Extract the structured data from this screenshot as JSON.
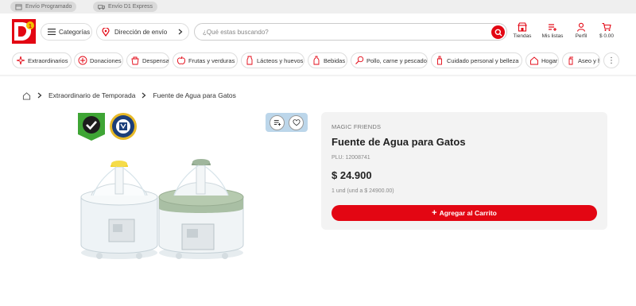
{
  "top_strip": {
    "scheduled": "Envío Programado",
    "express": "Envío D1 Express"
  },
  "header": {
    "logo_text": "D1",
    "categories_label": "Categorías",
    "address_label": "Dirección de envío",
    "search_placeholder": "¿Qué estas buscando?",
    "stores_label": "Tiendas",
    "lists_label": "Mis listas",
    "profile_label": "Perfil",
    "cart_label": "$ 0.00"
  },
  "categories": [
    {
      "label": "Extraordinarios",
      "icon": "sparkle-icon"
    },
    {
      "label": "Donaciones",
      "icon": "donation-icon"
    },
    {
      "label": "Despensa",
      "icon": "pantry-icon"
    },
    {
      "label": "Frutas y verduras",
      "icon": "apple-icon"
    },
    {
      "label": "Lácteos y huevos",
      "icon": "milk-icon"
    },
    {
      "label": "Bebidas",
      "icon": "bottle-icon"
    },
    {
      "label": "Pollo, carne y pescado",
      "icon": "drumstick-icon"
    },
    {
      "label": "Cuidado personal y belleza",
      "icon": "lotion-icon"
    },
    {
      "label": "Hogar",
      "icon": "home-icon"
    },
    {
      "label": "Aseo y h",
      "icon": "cleaning-icon"
    }
  ],
  "more_label": "⋮",
  "breadcrumb": {
    "level1": "Extraordinario de Temporada",
    "level2": "Fuente de Agua para Gatos"
  },
  "product": {
    "brand": "MAGIC FRIENDS",
    "name": "Fuente de Agua para Gatos",
    "plu": "PLU: 12008741",
    "price": "$ 24.900",
    "unit_price": "1 und (und a $ 24900.00)",
    "add_to_cart": "Agregar al Carrito",
    "add_icon": "+"
  },
  "colors": {
    "brand_red": "#e30613",
    "badge_green": "#3fa535",
    "action_blue": "#bcd6ea"
  }
}
